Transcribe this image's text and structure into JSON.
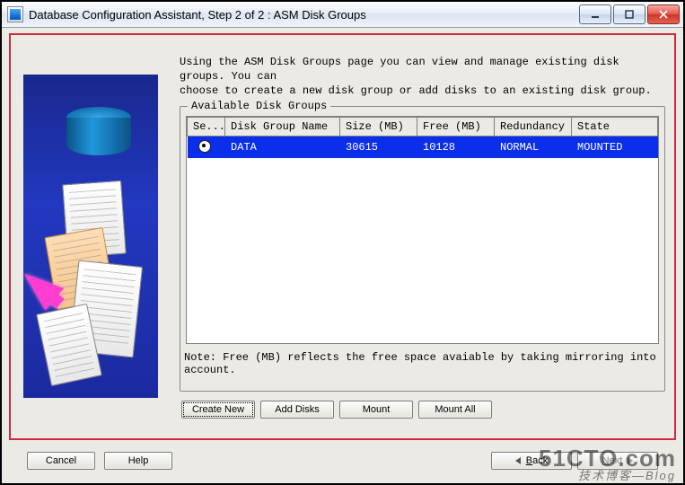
{
  "window": {
    "title": "Database Configuration Assistant, Step 2 of 2 : ASM Disk Groups"
  },
  "intro": {
    "line1": "Using the ASM Disk Groups page you can view and manage existing disk groups. You can",
    "line2": "choose to create a new disk group or add disks to an existing disk group."
  },
  "group_label": "Available Disk Groups",
  "columns": {
    "select": "Se...",
    "name": "Disk Group Name",
    "size": "Size (MB)",
    "free": "Free (MB)",
    "redundancy": "Redundancy",
    "state": "State"
  },
  "rows": [
    {
      "name": "DATA",
      "size": "30615",
      "free": "10128",
      "redundancy": "NORMAL",
      "state": "MOUNTED",
      "selected": true
    }
  ],
  "note": "Note: Free (MB) reflects the free space avaiable by taking mirroring into account.",
  "action_buttons": {
    "create_new": "Create New",
    "add_disks": "Add Disks",
    "mount": "Mount",
    "mount_all": "Mount All"
  },
  "nav": {
    "cancel": "Cancel",
    "help": "Help",
    "back": "Back",
    "next": "Next"
  },
  "mnemonics": {
    "back": "B",
    "next": "N"
  },
  "watermark": {
    "l1": "51CTO.com",
    "l2": "技术博客—Blog"
  }
}
